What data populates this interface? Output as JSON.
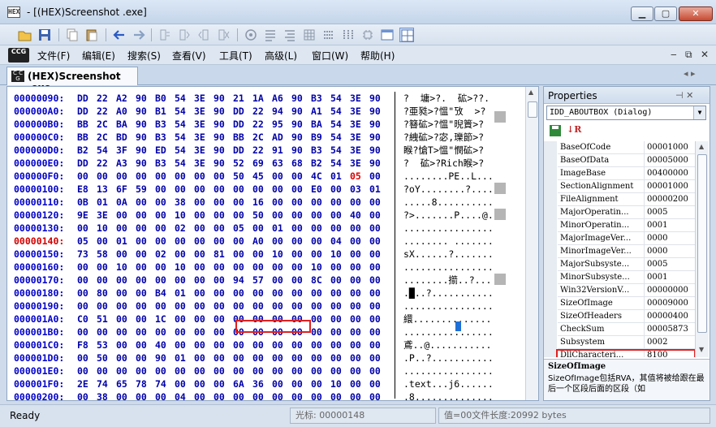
{
  "window": {
    "title": "- [(HEX)Screenshot .exe]",
    "icon_text": "HEX"
  },
  "menu": {
    "logo": "CCG",
    "items": [
      "文件(F)",
      "编辑(E)",
      "搜索(S)",
      "查看(V)",
      "工具(T)",
      "高级(L)",
      "窗口(W)",
      "帮助(H)"
    ]
  },
  "tab": {
    "label": "(HEX)Screenshot .exe"
  },
  "hex": {
    "rows": [
      {
        "addr": "00000090:",
        "bytes": [
          "DD",
          "22",
          "A2",
          "90",
          "B0",
          "54",
          "3E",
          "90",
          "21",
          "1A",
          "A6",
          "90",
          "B3",
          "54",
          "3E",
          "90"
        ],
        "ascii": "?  墉>?.  砿>??."
      },
      {
        "addr": "000000A0:",
        "bytes": [
          "DD",
          "22",
          "A0",
          "90",
          "B1",
          "54",
          "3E",
          "90",
          "DD",
          "22",
          "94",
          "90",
          "A1",
          "54",
          "3E",
          "90"
        ],
        "ascii": "?亜甤>?慍\"攷  >?"
      },
      {
        "addr": "000000B0:",
        "bytes": [
          "BB",
          "2C",
          "BA",
          "90",
          "B3",
          "54",
          "3E",
          "90",
          "DD",
          "22",
          "95",
          "90",
          "BA",
          "54",
          "3E",
          "90"
        ],
        "ascii": "?簮砿>?慍\"晲篢>?"
      },
      {
        "addr": "000000C0:",
        "bytes": [
          "BB",
          "2C",
          "BD",
          "90",
          "B3",
          "54",
          "3E",
          "90",
          "BB",
          "2C",
          "AD",
          "90",
          "B9",
          "54",
          "3E",
          "90"
        ],
        "ascii": "?絏砿>?宓,瓅節>?"
      },
      {
        "addr": "000000D0:",
        "bytes": [
          "B2",
          "54",
          "3F",
          "90",
          "ED",
          "54",
          "3E",
          "90",
          "DD",
          "22",
          "91",
          "90",
          "B3",
          "54",
          "3E",
          "90"
        ],
        "ascii": "睺?愴T>慍\"憫砿>?"
      },
      {
        "addr": "000000E0:",
        "bytes": [
          "DD",
          "22",
          "A3",
          "90",
          "B3",
          "54",
          "3E",
          "90",
          "52",
          "69",
          "63",
          "68",
          "B2",
          "54",
          "3E",
          "90"
        ],
        "ascii": "?  砿>?Rich睺>?"
      },
      {
        "addr": "000000F0:",
        "bytes": [
          "00",
          "00",
          "00",
          "00",
          "00",
          "00",
          "00",
          "00",
          "50",
          "45",
          "00",
          "00",
          "4C",
          "01",
          "05",
          "00"
        ],
        "ascii": "........PE..L..."
      },
      {
        "addr": "00000100:",
        "bytes": [
          "E8",
          "13",
          "6F",
          "59",
          "00",
          "00",
          "00",
          "00",
          "00",
          "00",
          "00",
          "00",
          "E0",
          "00",
          "03",
          "01"
        ],
        "ascii": "?oY........?...."
      },
      {
        "addr": "00000110:",
        "bytes": [
          "0B",
          "01",
          "0A",
          "00",
          "00",
          "38",
          "00",
          "00",
          "00",
          "16",
          "00",
          "00",
          "00",
          "00",
          "00",
          "00"
        ],
        "ascii": ".....8.........."
      },
      {
        "addr": "00000120:",
        "bytes": [
          "9E",
          "3E",
          "00",
          "00",
          "00",
          "10",
          "00",
          "00",
          "00",
          "50",
          "00",
          "00",
          "00",
          "00",
          "40",
          "00"
        ],
        "ascii": "?>.......P....@."
      },
      {
        "addr": "00000130:",
        "bytes": [
          "00",
          "10",
          "00",
          "00",
          "00",
          "02",
          "00",
          "00",
          "05",
          "00",
          "01",
          "00",
          "00",
          "00",
          "00",
          "00"
        ],
        "ascii": "................"
      },
      {
        "addr": "00000140:",
        "bytes": [
          "05",
          "00",
          "01",
          "00",
          "00",
          "00",
          "00",
          "00",
          "00",
          "A0",
          "00",
          "00",
          "00",
          "04",
          "00",
          "00"
        ],
        "ascii": "........ ......."
      },
      {
        "addr": "00000150:",
        "bytes": [
          "73",
          "58",
          "00",
          "00",
          "02",
          "00",
          "00",
          "81",
          "00",
          "00",
          "10",
          "00",
          "00",
          "10",
          "00",
          "00"
        ],
        "ascii": "sX......?......."
      },
      {
        "addr": "00000160:",
        "bytes": [
          "00",
          "00",
          "10",
          "00",
          "00",
          "10",
          "00",
          "00",
          "00",
          "00",
          "00",
          "00",
          "10",
          "00",
          "00",
          "00"
        ],
        "ascii": "................"
      },
      {
        "addr": "00000170:",
        "bytes": [
          "00",
          "00",
          "00",
          "00",
          "00",
          "00",
          "00",
          "00",
          "94",
          "57",
          "00",
          "00",
          "8C",
          "00",
          "00",
          "00"
        ],
        "ascii": "........擶..?..."
      },
      {
        "addr": "00000180:",
        "bytes": [
          "00",
          "80",
          "00",
          "00",
          "B4",
          "01",
          "00",
          "00",
          "00",
          "00",
          "00",
          "00",
          "00",
          "00",
          "00",
          "00"
        ],
        "ascii": ".█..?..........."
      },
      {
        "addr": "00000190:",
        "bytes": [
          "00",
          "00",
          "00",
          "00",
          "00",
          "00",
          "00",
          "00",
          "00",
          "00",
          "00",
          "00",
          "00",
          "00",
          "00",
          "00"
        ],
        "ascii": "................"
      },
      {
        "addr": "000001A0:",
        "bytes": [
          "C0",
          "51",
          "00",
          "00",
          "1C",
          "00",
          "00",
          "00",
          "00",
          "00",
          "00",
          "00",
          "00",
          "00",
          "00",
          "00"
        ],
        "ascii": "繯.............."
      },
      {
        "addr": "000001B0:",
        "bytes": [
          "00",
          "00",
          "00",
          "00",
          "00",
          "00",
          "00",
          "00",
          "00",
          "00",
          "00",
          "00",
          "00",
          "00",
          "00",
          "00"
        ],
        "ascii": "................"
      },
      {
        "addr": "000001C0:",
        "bytes": [
          "F8",
          "53",
          "00",
          "00",
          "40",
          "00",
          "00",
          "00",
          "00",
          "00",
          "00",
          "00",
          "00",
          "00",
          "00",
          "00"
        ],
        "ascii": "鳶..@..........."
      },
      {
        "addr": "000001D0:",
        "bytes": [
          "00",
          "50",
          "00",
          "00",
          "90",
          "01",
          "00",
          "00",
          "00",
          "00",
          "00",
          "00",
          "00",
          "00",
          "00",
          "00"
        ],
        "ascii": ".P..?..........."
      },
      {
        "addr": "000001E0:",
        "bytes": [
          "00",
          "00",
          "00",
          "00",
          "00",
          "00",
          "00",
          "00",
          "00",
          "00",
          "00",
          "00",
          "00",
          "00",
          "00",
          "00"
        ],
        "ascii": "................"
      },
      {
        "addr": "000001F0:",
        "bytes": [
          "2E",
          "74",
          "65",
          "78",
          "74",
          "00",
          "00",
          "00",
          "6A",
          "36",
          "00",
          "00",
          "00",
          "10",
          "00",
          "00"
        ],
        "ascii": ".text...j6......"
      },
      {
        "addr": "00000200:",
        "bytes": [
          "00",
          "38",
          "00",
          "00",
          "00",
          "04",
          "00",
          "00",
          "00",
          "00",
          "00",
          "00",
          "00",
          "00",
          "00",
          "00"
        ],
        "ascii": ".8.............."
      }
    ]
  },
  "properties": {
    "title": "Properties",
    "combo": "IDD_ABOUTBOX (Dialog)",
    "items": [
      {
        "name": "BaseOfCode",
        "value": "00001000"
      },
      {
        "name": "BaseOfData",
        "value": "00005000"
      },
      {
        "name": "ImageBase",
        "value": "00400000"
      },
      {
        "name": "SectionAlignment",
        "value": "00001000"
      },
      {
        "name": "FileAlignment",
        "value": "00000200"
      },
      {
        "name": "MajorOperatin...",
        "value": "0005"
      },
      {
        "name": "MinorOperatin...",
        "value": "0001"
      },
      {
        "name": "MajorImageVer...",
        "value": "0000"
      },
      {
        "name": "MinorImageVer...",
        "value": "0000"
      },
      {
        "name": "MajorSubsyste...",
        "value": "0005"
      },
      {
        "name": "MinorSubsyste...",
        "value": "0001"
      },
      {
        "name": "Win32VersionV...",
        "value": "00000000"
      },
      {
        "name": "SizeOfImage",
        "value": "00009000"
      },
      {
        "name": "SizeOfHeaders",
        "value": "00000400"
      },
      {
        "name": "CheckSum",
        "value": "00005873"
      },
      {
        "name": "Subsystem",
        "value": "0002"
      },
      {
        "name": "DllCharacteri...",
        "value": "8100"
      }
    ],
    "desc_title": "SizeOfImage",
    "desc_text": "SizeOfImage包括RVA，其值将被给跟在最后一个区段后面的区段（如"
  },
  "status": {
    "ready": "Ready",
    "cursor": "光标: 00000148",
    "length": "值=00文件长度:20992 bytes"
  },
  "colors": {
    "address": "#0000cc",
    "current_address": "#d40000",
    "bytes": "#0000aa",
    "highlight_border": "#e02020"
  }
}
